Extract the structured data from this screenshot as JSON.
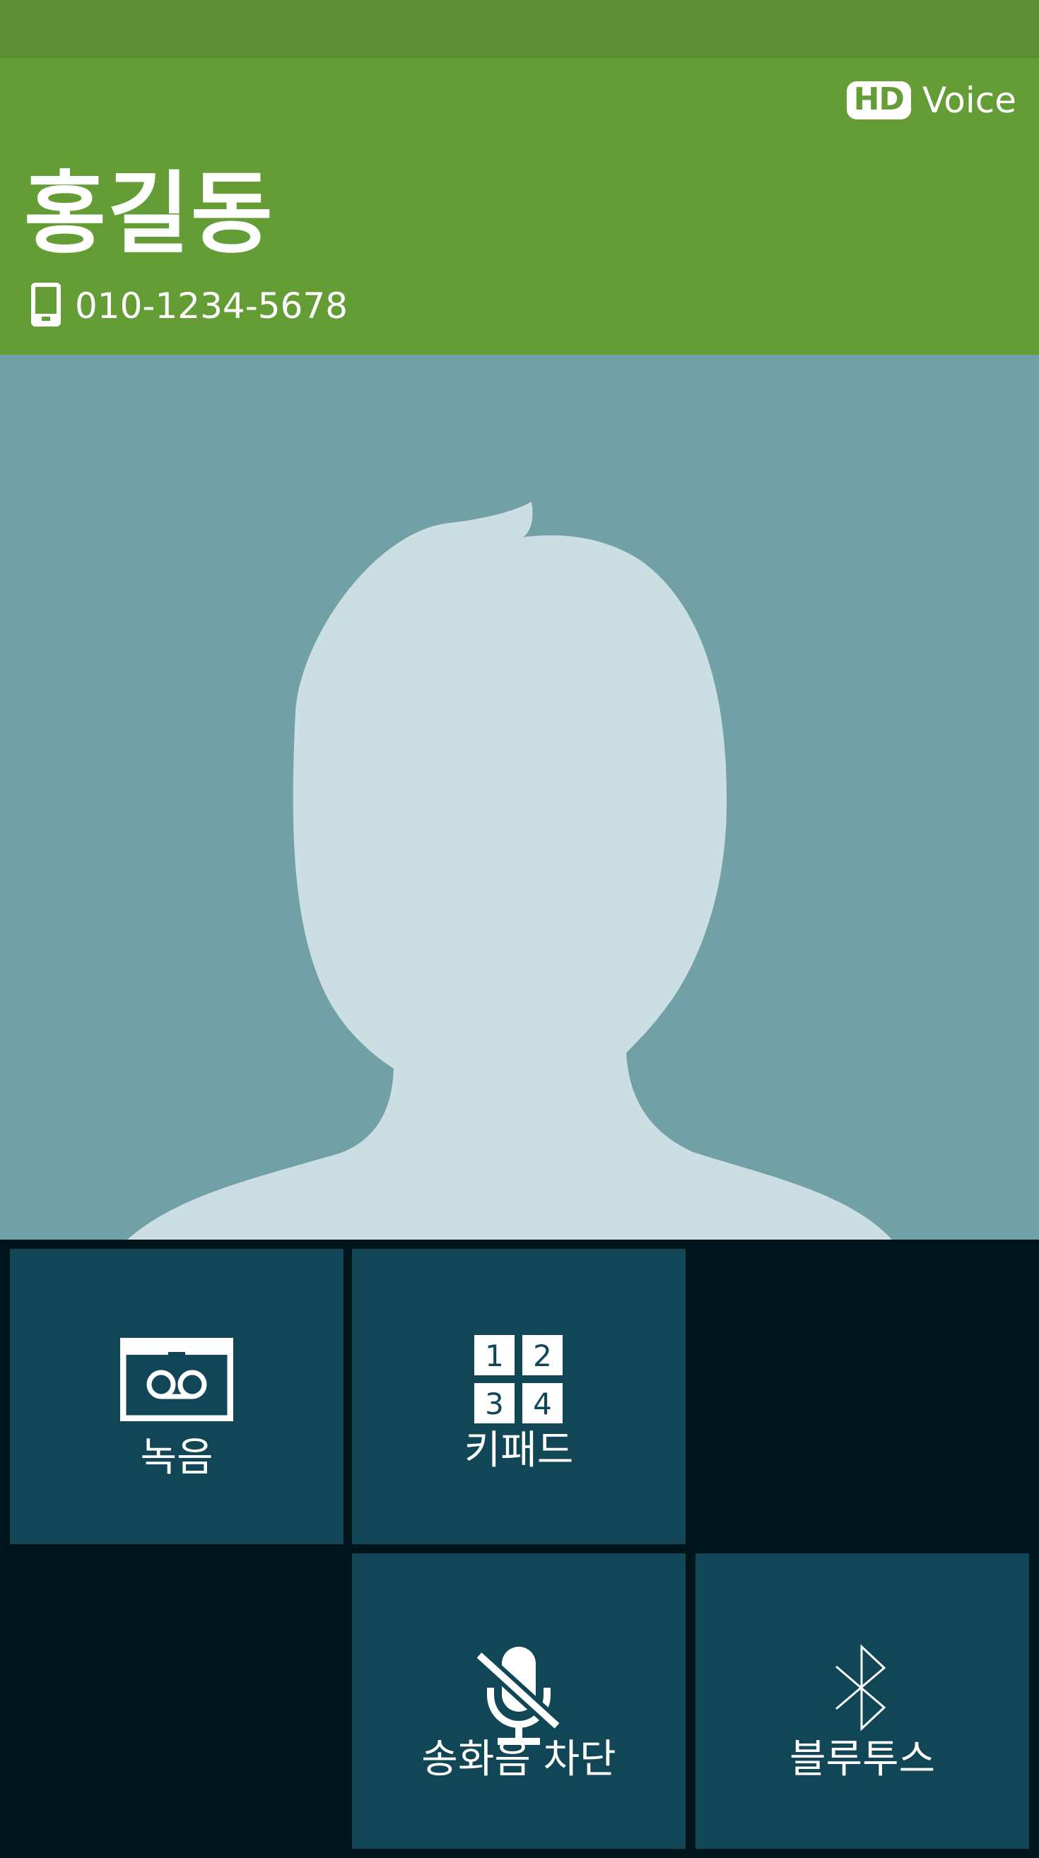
{
  "header": {
    "hd_badge": "HD",
    "hd_label": "Voice",
    "contact_name": "홍길동",
    "phone_number": "010-1234-5678"
  },
  "controls": {
    "record": {
      "label": "녹음",
      "icon": "cassette-record-icon"
    },
    "keypad": {
      "label": "키패드",
      "icon": "keypad-icon",
      "keys": [
        "1",
        "2",
        "3",
        "4"
      ]
    },
    "mute": {
      "label": "송화음 차단",
      "icon": "microphone-muted-icon"
    },
    "bluetooth": {
      "label": "블루투스",
      "icon": "bluetooth-icon"
    }
  },
  "colors": {
    "status_bar": "#5e8b34",
    "header": "#649d36",
    "photo_bg": "#72a0a7",
    "silhouette": "#cbdee2",
    "tile": "#104655",
    "controls_bg": "#00141b"
  }
}
